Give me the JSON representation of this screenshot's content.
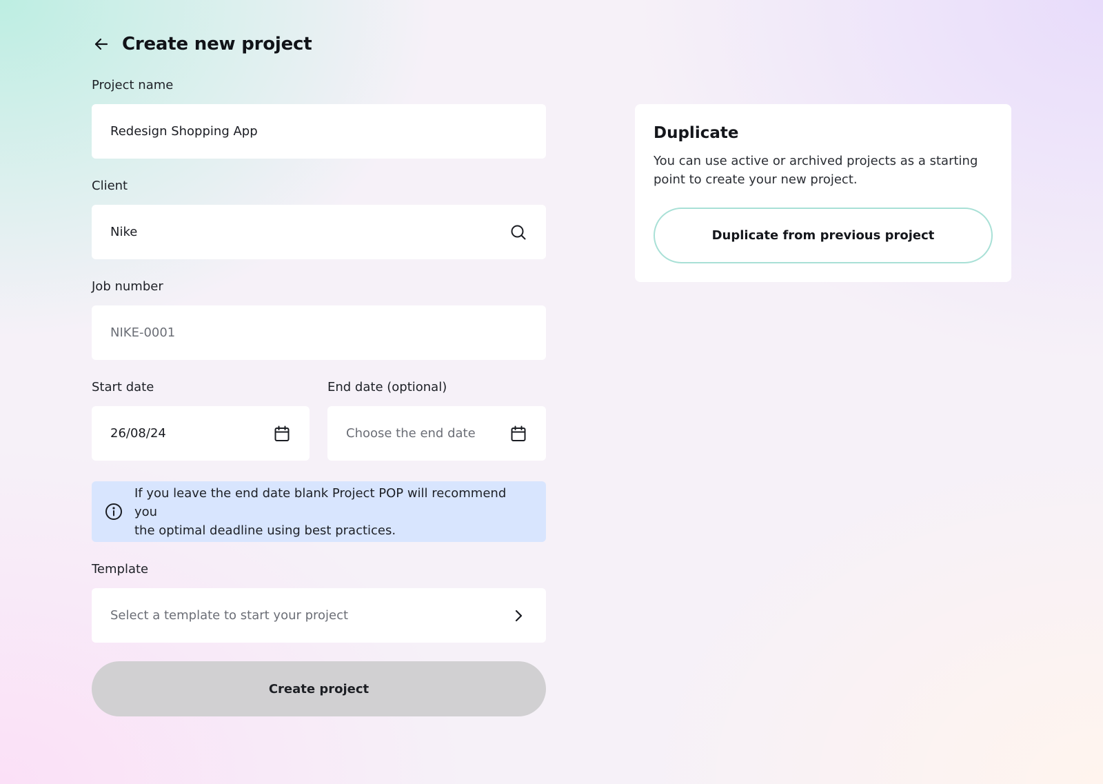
{
  "header": {
    "title": "Create new project",
    "back_icon": "arrow-left-icon"
  },
  "form": {
    "project_name": {
      "label": "Project name",
      "value": "Redesign Shopping App"
    },
    "client": {
      "label": "Client",
      "value": "Nike",
      "icon": "search-icon"
    },
    "job_number": {
      "label": "Job number",
      "placeholder": "NIKE-0001"
    },
    "start_date": {
      "label": "Start date",
      "value": "26/08/24",
      "icon": "calendar-icon"
    },
    "end_date": {
      "label": "End date (optional)",
      "placeholder": "Choose the end date",
      "icon": "calendar-icon"
    },
    "info": {
      "icon": "info-icon",
      "text_line1": "If you leave the end date blank Project POP will recommend you",
      "text_line2": "the optimal deadline using best practices."
    },
    "template": {
      "label": "Template",
      "placeholder": "Select a template to start your project",
      "icon": "chevron-right-icon"
    },
    "submit_label": "Create project"
  },
  "duplicate": {
    "title": "Duplicate",
    "desc_line1": "You can use active or archived projects as a starting",
    "desc_line2": "point to create your new project.",
    "button_label": "Duplicate from previous project"
  },
  "colors": {
    "info_bg": "#d8e5fe",
    "disabled_button": "#d1d0d2",
    "accent_border": "#a8e0d6"
  }
}
